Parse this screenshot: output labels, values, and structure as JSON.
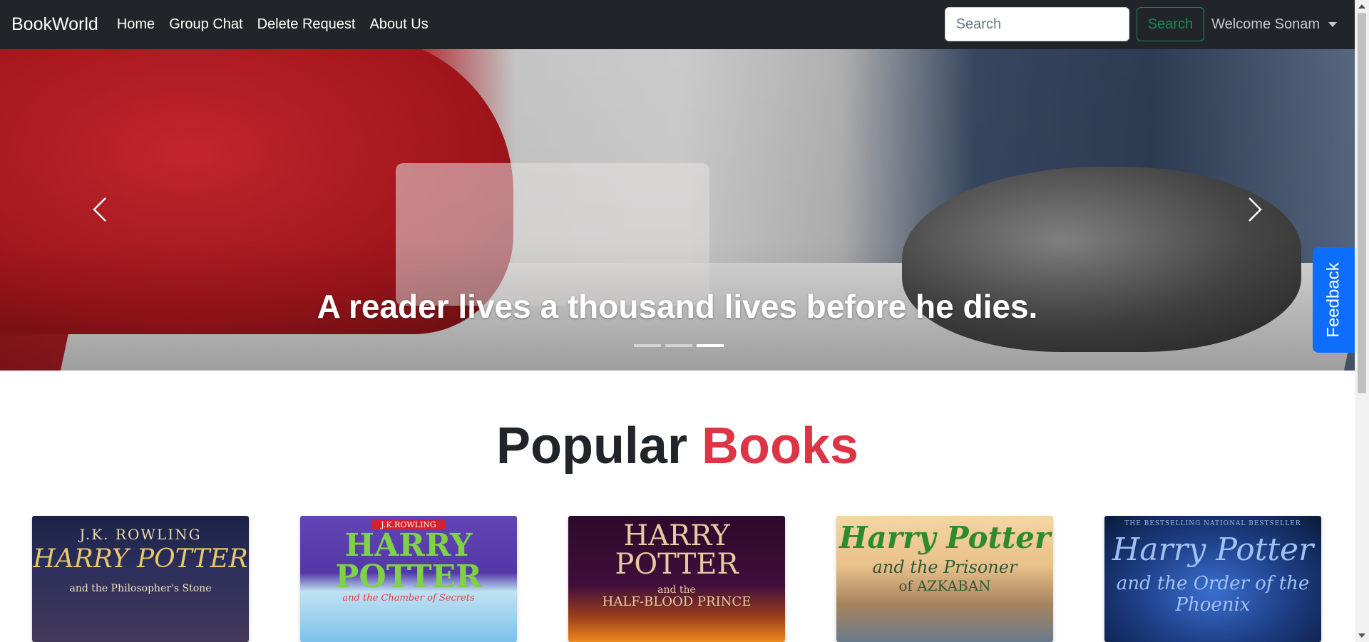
{
  "navbar": {
    "brand": "BookWorld",
    "links": [
      "Home",
      "Group Chat",
      "Delete Request",
      "About Us"
    ],
    "search_placeholder": "Search",
    "search_button": "Search",
    "welcome": "Welcome Sonam"
  },
  "carousel": {
    "caption": "A reader lives a thousand lives before he dies.",
    "slide_count": 3,
    "active_slide_index": 2
  },
  "feedback": {
    "label": "Feedback"
  },
  "popular": {
    "title_part1": "Popular",
    "title_part2": "Books"
  },
  "books": [
    {
      "line0": "",
      "line1": "J.K. ROWLING",
      "line2": "HARRY POTTER",
      "line3": "and the Philosopher's Stone"
    },
    {
      "line0": "",
      "line1": "J.K.ROWLING",
      "line2": "HARRY POTTER",
      "line3": "and the Chamber of Secrets"
    },
    {
      "line0": "",
      "line1": "HARRY POTTER",
      "line2": "and the",
      "line3": "HALF-BLOOD PRINCE"
    },
    {
      "line0": "",
      "line1": "Harry Potter",
      "line2": "and the Prisoner",
      "line3": "of AZKABAN"
    },
    {
      "line0": "THE BESTSELLING NATIONAL BESTSELLER",
      "line1": "Harry Potter",
      "line2": "and the Order of the Phoenix",
      "line3": ""
    }
  ],
  "colors": {
    "navbar_bg": "#212529",
    "accent_red": "#dc3545",
    "search_button": "#198754",
    "feedback_bg": "#0d6efd"
  },
  "icons": [
    "chevron-left-icon",
    "chevron-right-icon",
    "caret-down-icon"
  ]
}
